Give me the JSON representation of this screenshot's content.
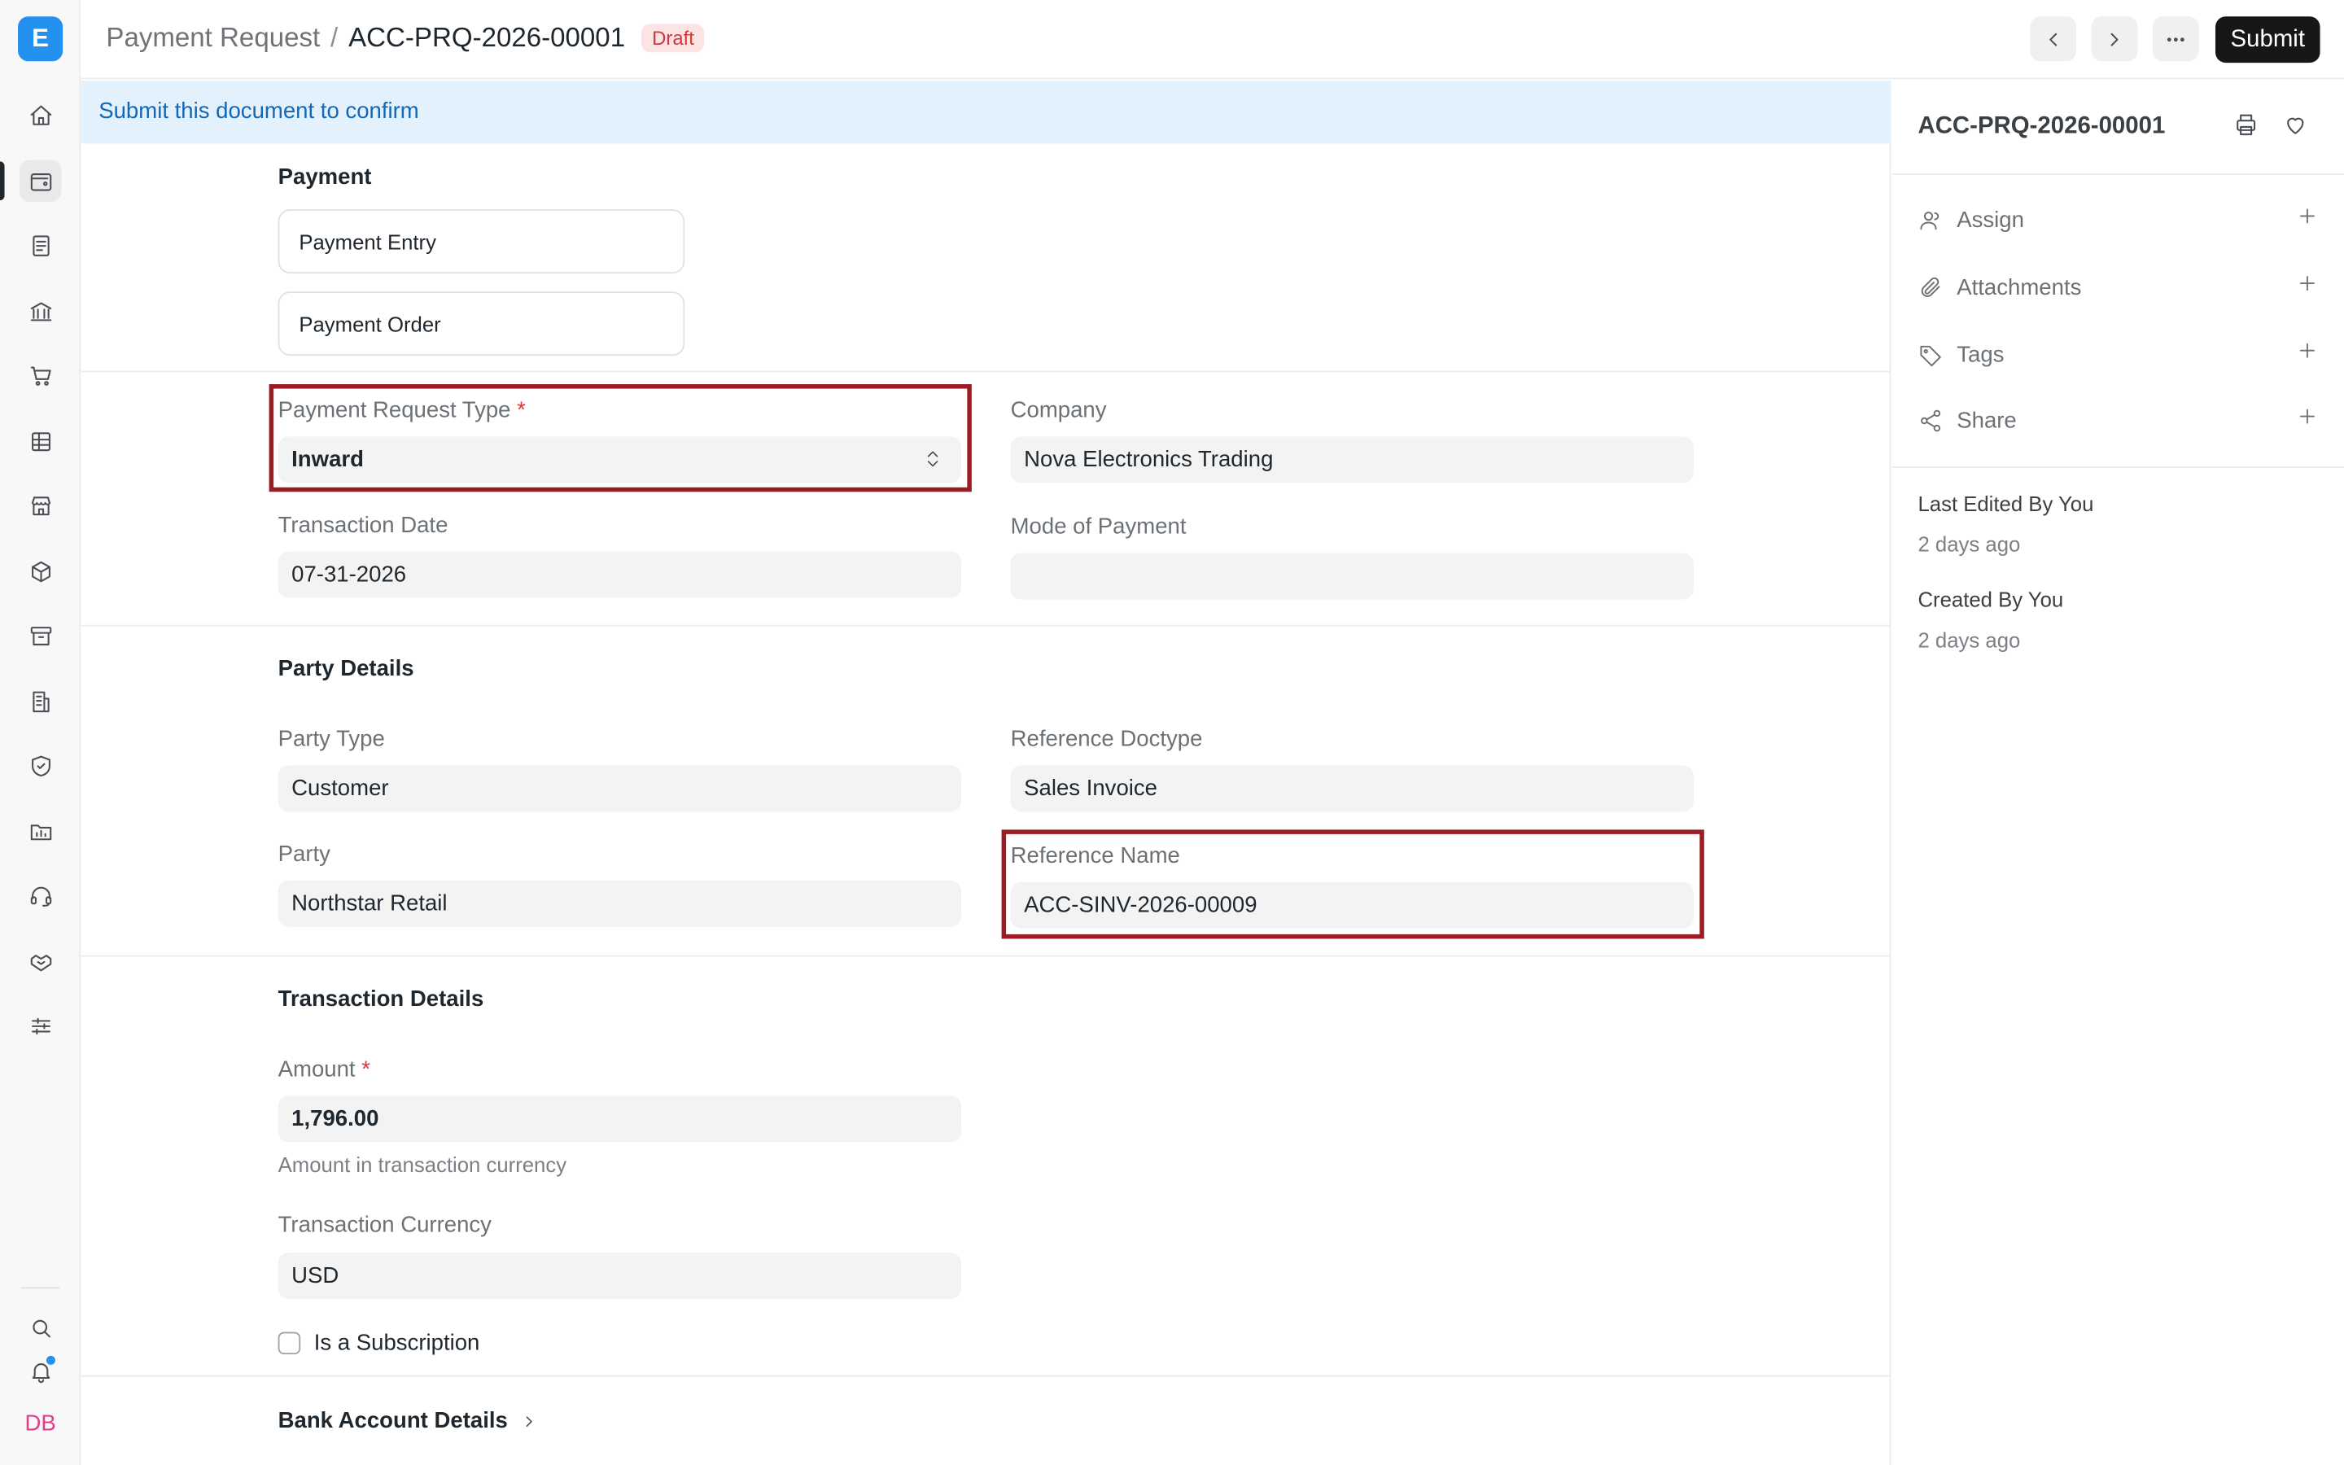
{
  "app": {
    "logo_letter": "E"
  },
  "rail": {
    "items": [
      {
        "icon": "home-icon"
      },
      {
        "icon": "wallet-icon"
      },
      {
        "icon": "invoice-icon"
      },
      {
        "icon": "bank-icon"
      },
      {
        "icon": "cart-icon"
      },
      {
        "icon": "table-icon"
      },
      {
        "icon": "store-icon"
      },
      {
        "icon": "package-icon"
      },
      {
        "icon": "archive-icon"
      },
      {
        "icon": "building-icon"
      },
      {
        "icon": "shield-icon"
      },
      {
        "icon": "folder-chart-icon"
      },
      {
        "icon": "headset-icon"
      },
      {
        "icon": "handshake-icon"
      },
      {
        "icon": "sliders-icon"
      }
    ],
    "search_icon": "search-icon",
    "bell_icon": "bell-icon",
    "avatar_initials": "DB"
  },
  "header": {
    "breadcrumb_parent": "Payment Request",
    "breadcrumb_separator": "/",
    "breadcrumb_current": "ACC-PRQ-2026-00001",
    "status_badge": "Draft",
    "submit_label": "Submit"
  },
  "banner": {
    "text": "Submit this document to confirm"
  },
  "form": {
    "payment_section": {
      "title": "Payment",
      "links": [
        "Payment Entry",
        "Payment Order"
      ]
    },
    "payment_request_type": {
      "label": "Payment Request Type",
      "required_mark": "*",
      "value": "Inward"
    },
    "company": {
      "label": "Company",
      "value": "Nova Electronics Trading"
    },
    "transaction_date": {
      "label": "Transaction Date",
      "value": "07-31-2026"
    },
    "mode_of_payment": {
      "label": "Mode of Payment",
      "value": ""
    },
    "party_section": {
      "title": "Party Details"
    },
    "party_type": {
      "label": "Party Type",
      "value": "Customer"
    },
    "reference_doctype": {
      "label": "Reference Doctype",
      "value": "Sales Invoice"
    },
    "party": {
      "label": "Party",
      "value": "Northstar Retail"
    },
    "reference_name": {
      "label": "Reference Name",
      "value": "ACC-SINV-2026-00009"
    },
    "transaction_section": {
      "title": "Transaction Details"
    },
    "amount": {
      "label": "Amount",
      "required_mark": "*",
      "value": "1,796.00",
      "help": "Amount in transaction currency"
    },
    "transaction_currency": {
      "label": "Transaction Currency",
      "value": "USD"
    },
    "is_subscription": {
      "label": "Is a Subscription",
      "checked": false
    },
    "bank_section": {
      "title": "Bank Account Details"
    }
  },
  "sidebar": {
    "doc_name": "ACC-PRQ-2026-00001",
    "actions": [
      {
        "label": "Assign",
        "icon": "user-icon"
      },
      {
        "label": "Attachments",
        "icon": "paperclip-icon"
      },
      {
        "label": "Tags",
        "icon": "tag-icon"
      },
      {
        "label": "Share",
        "icon": "share-icon"
      }
    ],
    "last_edited_label": "Last Edited By You",
    "last_edited_time": "2 days ago",
    "created_label": "Created By You",
    "created_time": "2 days ago"
  },
  "colors": {
    "accent": "#2490ef",
    "highlight": "#9b1c22",
    "banner_bg": "#e3f1fc",
    "draft_badge": "#d1383b"
  }
}
